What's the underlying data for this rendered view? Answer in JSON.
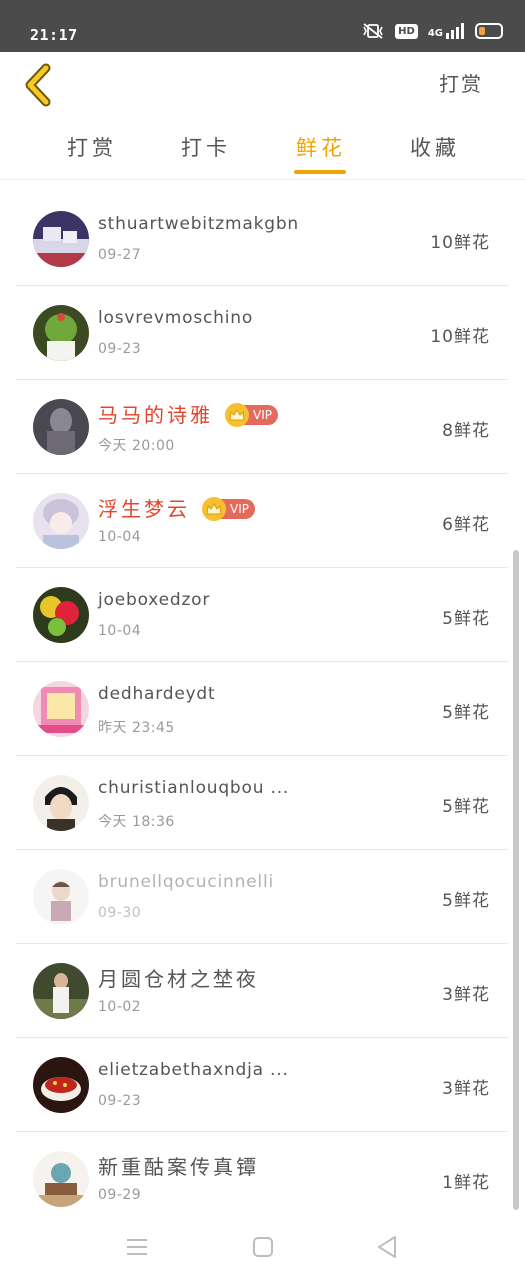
{
  "status_bar": {
    "time": "21:17",
    "hd": "HD",
    "network": "4G",
    "battery_level": 0.3
  },
  "header": {
    "back_icon": "chevron-left-icon",
    "action_label": "打赏"
  },
  "tabs": [
    {
      "label": "打赏",
      "active": false
    },
    {
      "label": "打卡",
      "active": false
    },
    {
      "label": "鲜花",
      "active": true
    },
    {
      "label": "收藏",
      "active": false
    }
  ],
  "list": [
    {
      "name": "sthuartwebitzmakgbn",
      "date": "09-27",
      "amount": "10鲜花",
      "vip": false
    },
    {
      "name": "losvrevmoschino",
      "date": "09-23",
      "amount": "10鲜花",
      "vip": false
    },
    {
      "name": "马马的诗雅",
      "date": "今天 20:00",
      "amount": "8鲜花",
      "vip": true,
      "vip_label": "VIP"
    },
    {
      "name": "浮生梦云",
      "date": "10-04",
      "amount": "6鲜花",
      "vip": true,
      "vip_label": "VIP"
    },
    {
      "name": "joeboxedzor",
      "date": "10-04",
      "amount": "5鲜花",
      "vip": false
    },
    {
      "name": "dedhardeydt",
      "date": "昨天 23:45",
      "amount": "5鲜花",
      "vip": false
    },
    {
      "name": "churistianlouqbou ...",
      "date": "今天 18:36",
      "amount": "5鲜花",
      "vip": false
    },
    {
      "name": "brunellqocucinnelli",
      "date": "09-30",
      "amount": "5鲜花",
      "vip": false,
      "faded": true
    },
    {
      "name": "月圆仓材之埜夜",
      "date": "10-02",
      "amount": "3鲜花",
      "vip": false
    },
    {
      "name": "elietzabethaxndja ...",
      "date": "09-23",
      "amount": "3鲜花",
      "vip": false
    },
    {
      "name": "新重酤案传真镡",
      "date": "09-29",
      "amount": "1鲜花",
      "vip": false
    }
  ],
  "colors": {
    "accent": "#f0a400",
    "vip_name": "#e2452c",
    "vip_badge": "#e56a5e",
    "status_bar": "#4b4b4b"
  },
  "nav_bar": {
    "menu_icon": "menu-icon",
    "home_icon": "home-square-icon",
    "back_icon": "back-triangle-icon"
  }
}
